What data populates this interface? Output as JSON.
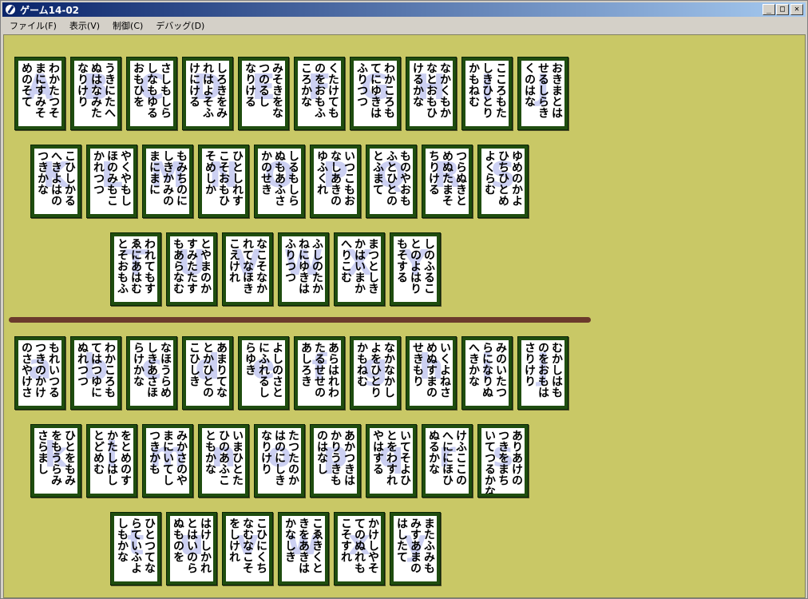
{
  "window": {
    "title": "ゲーム14-02",
    "controls": {
      "minimize": "_",
      "maximize": "□",
      "close": "✕"
    }
  },
  "menu": [
    {
      "label": "ファイル(F)"
    },
    {
      "label": "表示(V)"
    },
    {
      "label": "制御(C)"
    },
    {
      "label": "デバッグ(D)"
    }
  ],
  "colors": {
    "board": "#c9c866",
    "card_border": "#1f4d0f",
    "divider": "#6b3a2c",
    "watermark": "#ccd0f2"
  },
  "top_area": {
    "rows": [
      [
        {
          "text": "わかたつそ\nまにすみそ\nめのそて",
          "wm": "A"
        },
        {
          "text": "うきにたへ\nぬはなみた\nなりけり",
          "wm": "B"
        },
        {
          "text": "さしもしら\nしなもゆる\nおもひを",
          "wm": "C"
        },
        {
          "text": "しろきをみ\nれはよそふ\nけにける",
          "wm": "D"
        },
        {
          "text": "みそきをな\nつのるし\nなりける",
          "wm": "E"
        },
        {
          "text": "くたけても\nのをおもふ\nころかな",
          "wm": "F"
        },
        {
          "text": "わかころも\nてにゆきは\nふりつつ",
          "wm": "G"
        },
        {
          "text": "なかくもか\nなとおもひ\nけるかな",
          "wm": "H"
        },
        {
          "text": "こころもた\nしきひとり\nかもねむ",
          "wm": "I"
        },
        {
          "text": "おきまとは\nせるしらき\nくのはな",
          "wm": "J"
        }
      ],
      [
        {
          "text": "こひしかる\nへきよはの\nつきかな",
          "wm": "K"
        },
        {
          "text": "やくやもし\nほのみもこ\nかれつつ",
          "wm": "L"
        },
        {
          "text": "もみちのに\nしきかみの\nまにまに",
          "wm": "M"
        },
        {
          "text": "ひとしれす\nこそおもひ\nそめしか",
          "wm": "N"
        },
        {
          "text": "しるもしら\nぬもあふさ\nかのせき",
          "wm": "O"
        },
        {
          "text": "いつこもお\nなしあきの\nゆふくれ",
          "wm": "P"
        },
        {
          "text": "ものやおも\nふとひとの\nとふまて",
          "wm": "Q"
        },
        {
          "text": "つらぬきと\nめぬたまそ\nちりける",
          "wm": "R"
        },
        {
          "text": "ゆめのかよ\nひちひとめ\nよくらむ",
          "wm": "S"
        }
      ],
      [
        {
          "text": "われてもす\nゑにあはむ\nとそおもふ",
          "wm": "T"
        },
        {
          "text": "とやまのか\nすみたたす\nもあらなむ",
          "wm": "U"
        },
        {
          "text": "なこそなか\nれてなほき\nこえけれ",
          "wm": "V"
        },
        {
          "text": "ふしのたか\nねにゆきは\nふりつつ",
          "wm": "W"
        },
        {
          "text": "まつとしき\nかはいまか\nへりこむ",
          "wm": "X"
        },
        {
          "text": "しのふるこ\nとのよはり\nもそする",
          "wm": "Y"
        }
      ]
    ]
  },
  "bottom_area": {
    "rows": [
      [
        {
          "text": "もれいつる\nつきのかけ\nのさやけさ",
          "wm": "a"
        },
        {
          "text": "わかころも\nてはつゆに\nぬれつつ",
          "wm": "b"
        },
        {
          "text": "なほうらめ\nしきあさほ\nらけかな",
          "wm": "c"
        },
        {
          "text": "あまりてな\nとかひとの\nこひしき",
          "wm": "d"
        },
        {
          "text": "よしのさと\nにふれるし\nらゆき",
          "wm": "e"
        },
        {
          "text": "あらはれわ\nたるせせの\nあしろき",
          "wm": "f"
        },
        {
          "text": "なかなかし\nよをひとり\nかもねむ",
          "wm": "g"
        },
        {
          "text": "いくよねさ\nめぬすまの\nせきもり",
          "wm": "h"
        },
        {
          "text": "みのいたつ\nらになりぬ\nへきかな",
          "wm": "i"
        },
        {
          "text": "むかしはも\nのをおもは\nさりけり",
          "wm": "j"
        }
      ],
      [
        {
          "text": "ひとをもみ\nをもうらみ\nさらまし",
          "wm": "k"
        },
        {
          "text": "をとめのす\nかたしはし\nとどめむ",
          "wm": "l"
        },
        {
          "text": "みかさのや\nまにいてし\nつきかも",
          "wm": "m"
        },
        {
          "text": "いまひとた\nひのあふこ\nともかな",
          "wm": "n"
        },
        {
          "text": "たつたのか\nはのにしき\nなりけり",
          "wm": "o"
        },
        {
          "text": "あかつきは\nかりうきも\nのはなし",
          "wm": "p"
        },
        {
          "text": "いてそよひ\nとをわすれ\nやはする",
          "wm": "q"
        },
        {
          "text": "けふここの\nへににほひ\nぬるかな",
          "wm": "r"
        },
        {
          "text": "ありあけの\nつきをまち\nいてつるかな",
          "wm": "s"
        }
      ],
      [
        {
          "text": "ひとつてな\nらていふよ\nしもかな",
          "wm": "t"
        },
        {
          "text": "はけしかれ\nとはいのら\nぬものを",
          "wm": "u"
        },
        {
          "text": "こひにくち\nなむなこそ\nをしけれ",
          "wm": "v"
        },
        {
          "text": "こゑきくと\nきをあきは\nかなしき",
          "wm": "w"
        },
        {
          "text": "かけしやそ\nてのぬれも\nこそすれ",
          "wm": "x"
        },
        {
          "text": "またふみも\nみすあまの\nはしたて",
          "wm": "y"
        }
      ]
    ]
  }
}
